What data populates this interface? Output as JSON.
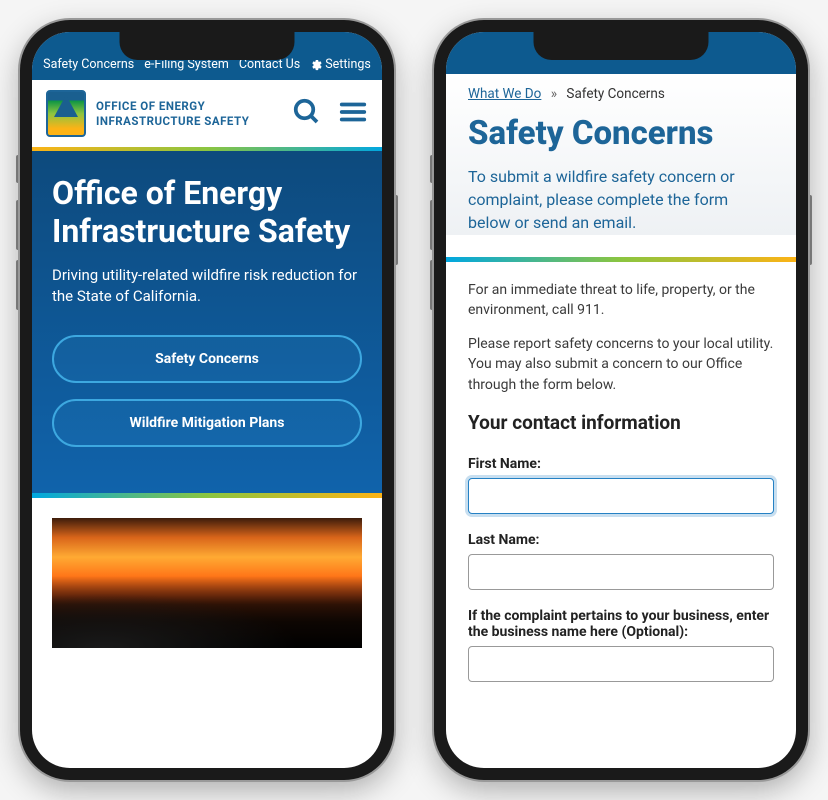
{
  "phone1": {
    "top_nav": {
      "safety_concerns": "Safety Concerns",
      "efiling": "e-Filing System",
      "contact": "Contact Us",
      "settings": "Settings"
    },
    "org_name": "OFFICE OF ENERGY INFRASTRUCTURE SAFETY",
    "hero": {
      "title": "Office of Energy Infrastructure Safety",
      "subtitle": "Driving utility-related wildfire risk reduction for the State of California.",
      "btn1": "Safety Concerns",
      "btn2": "Wildfire Mitigation Plans"
    }
  },
  "phone2": {
    "breadcrumb": {
      "parent": "What We Do",
      "sep": "»",
      "current": "Safety Concerns"
    },
    "title": "Safety Concerns",
    "intro": "To submit a wildfire safety concern or complaint, please complete the form below or send an email.",
    "body": {
      "p1": "For an immediate threat to life, property, or the environment, call 911.",
      "p2": "Please report safety concerns to your local utility. You may also submit a concern to our Office through the form below."
    },
    "section_heading": "Your contact information",
    "fields": {
      "first_name": "First Name:",
      "last_name": "Last Name:",
      "business": "If the complaint pertains to your business, enter the business name here (Optional):"
    }
  }
}
